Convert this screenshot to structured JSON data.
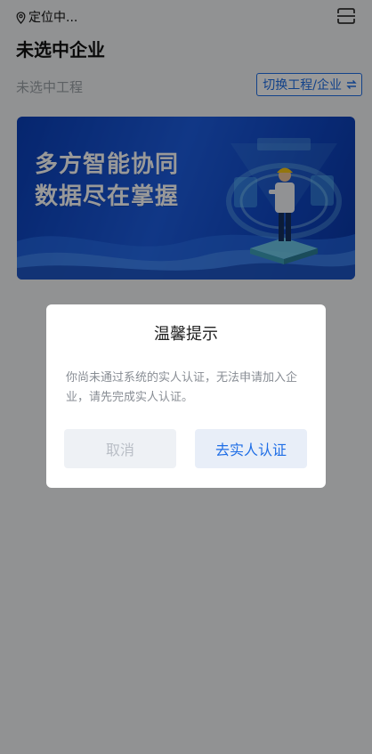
{
  "header": {
    "location_icon": "location-pin-icon",
    "location_text": "定位中...",
    "scan_icon": "scan-icon",
    "company_title": "未选中企业"
  },
  "project": {
    "label": "未选中工程",
    "switch_button_label": "切换工程/企业",
    "switch_icon": "swap-icon"
  },
  "banner": {
    "line1": "多方智能协同",
    "line2": "数据尽在掌握"
  },
  "dialog": {
    "title": "温馨提示",
    "message": "你尚未通过系统的实人认证，无法申请加入企业，请先完成实人认证。",
    "cancel_label": "取消",
    "confirm_label": "去实人认证"
  },
  "colors": {
    "accent": "#1f6ee6",
    "mask": "rgba(0,0,0,0.40)",
    "banner_blue": "#1d5de0"
  }
}
